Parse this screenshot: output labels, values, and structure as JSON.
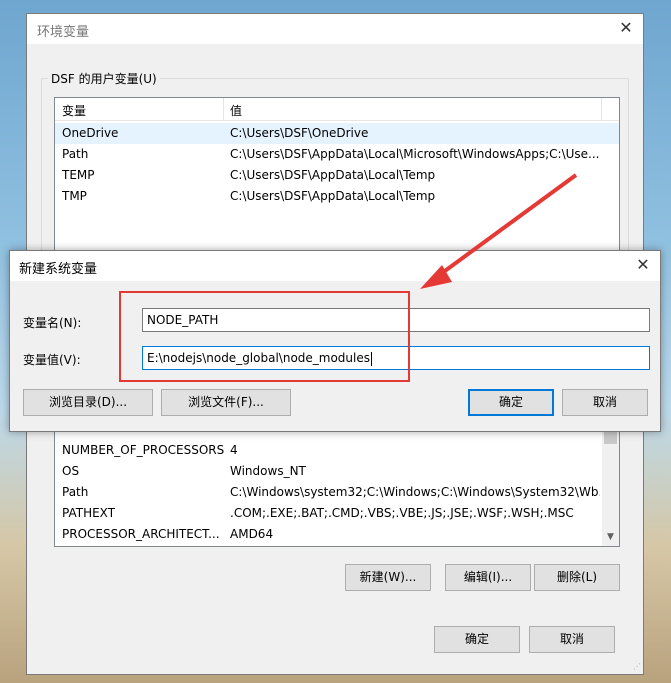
{
  "main_dialog": {
    "title": "环境变量",
    "close_glyph": "✕",
    "user_group_label": "DSF 的用户变量(U)",
    "user_columns": [
      "变量",
      "值"
    ],
    "user_rows": [
      {
        "name": "OneDrive",
        "value": "C:\\Users\\DSF\\OneDrive"
      },
      {
        "name": "Path",
        "value": "C:\\Users\\DSF\\AppData\\Local\\Microsoft\\WindowsApps;C:\\Use..."
      },
      {
        "name": "TEMP",
        "value": "C:\\Users\\DSF\\AppData\\Local\\Temp"
      },
      {
        "name": "TMP",
        "value": "C:\\Users\\DSF\\AppData\\Local\\Temp"
      }
    ],
    "system_rows": [
      {
        "name": "NUMBER_OF_PROCESSORS",
        "value": "4"
      },
      {
        "name": "OS",
        "value": "Windows_NT"
      },
      {
        "name": "Path",
        "value": "C:\\Windows\\system32;C:\\Windows;C:\\Windows\\System32\\Wb..."
      },
      {
        "name": "PATHEXT",
        "value": ".COM;.EXE;.BAT;.CMD;.VBS;.VBE;.JS;.JSE;.WSF;.WSH;.MSC"
      },
      {
        "name": "PROCESSOR_ARCHITECT...",
        "value": "AMD64"
      }
    ],
    "buttons": {
      "new": "新建(W)...",
      "edit": "编辑(I)...",
      "delete": "删除(L)",
      "ok": "确定",
      "cancel": "取消"
    }
  },
  "new_var_dialog": {
    "title": "新建系统变量",
    "close_glyph": "✕",
    "name_label": "变量名(N):",
    "name_value": "NODE_PATH",
    "value_label": "变量值(V):",
    "value_value": "E:\\nodejs\\node_global\\node_modules",
    "buttons": {
      "browse_dir": "浏览目录(D)...",
      "browse_file": "浏览文件(F)...",
      "ok": "确定",
      "cancel": "取消"
    }
  },
  "colors": {
    "annotation_red": "#e53935",
    "selection": "#e5f3ff",
    "focus_blue": "#0078d7"
  }
}
